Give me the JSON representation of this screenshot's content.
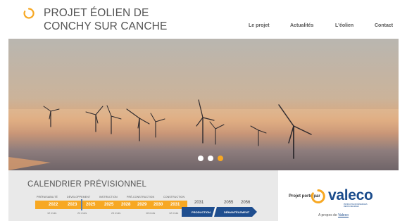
{
  "header": {
    "title_line1": "PROJET ÉOLIEN DE",
    "title_line2": "CONCHY SUR CANCHE",
    "nav": [
      {
        "label": "Le projet"
      },
      {
        "label": "Actualités"
      },
      {
        "label": "L'éolien"
      },
      {
        "label": "Contact"
      }
    ]
  },
  "colors": {
    "accent": "#f7a823",
    "brand_blue": "#1b4c8c"
  },
  "carousel": {
    "slide_count": 3,
    "active_slide": 3
  },
  "calendar": {
    "title": "CALENDRIER PRÉVISIONNEL",
    "phases": [
      "PRÉFAISABILITÉ",
      "DÉVELOPPEMENT",
      "INSTRUCTION",
      "PRÉ-CONSTRUCTION",
      "CONSTRUCTION"
    ],
    "years_bar": [
      "2022",
      "2023",
      "2025",
      "2025",
      "2028",
      "2029",
      "2030",
      "2031"
    ],
    "durations": [
      "12 mois",
      "24 mois",
      "24 mois",
      "18 mois",
      "12 mois"
    ],
    "year_production": "2031",
    "year_decommission_start": "2055",
    "year_decommission_end": "2056",
    "production_label": "PRODUCTION",
    "decommission_label": "DÉMANTÈLEMENT"
  },
  "partner": {
    "label": "Projet porté par",
    "brand": "valeco",
    "tagline_line1": "PRODUCTEUR D'ÉNERGIES",
    "tagline_line2": "RENOUVELABLES",
    "about_prefix": "A propos de ",
    "about_link": "Valeco"
  }
}
